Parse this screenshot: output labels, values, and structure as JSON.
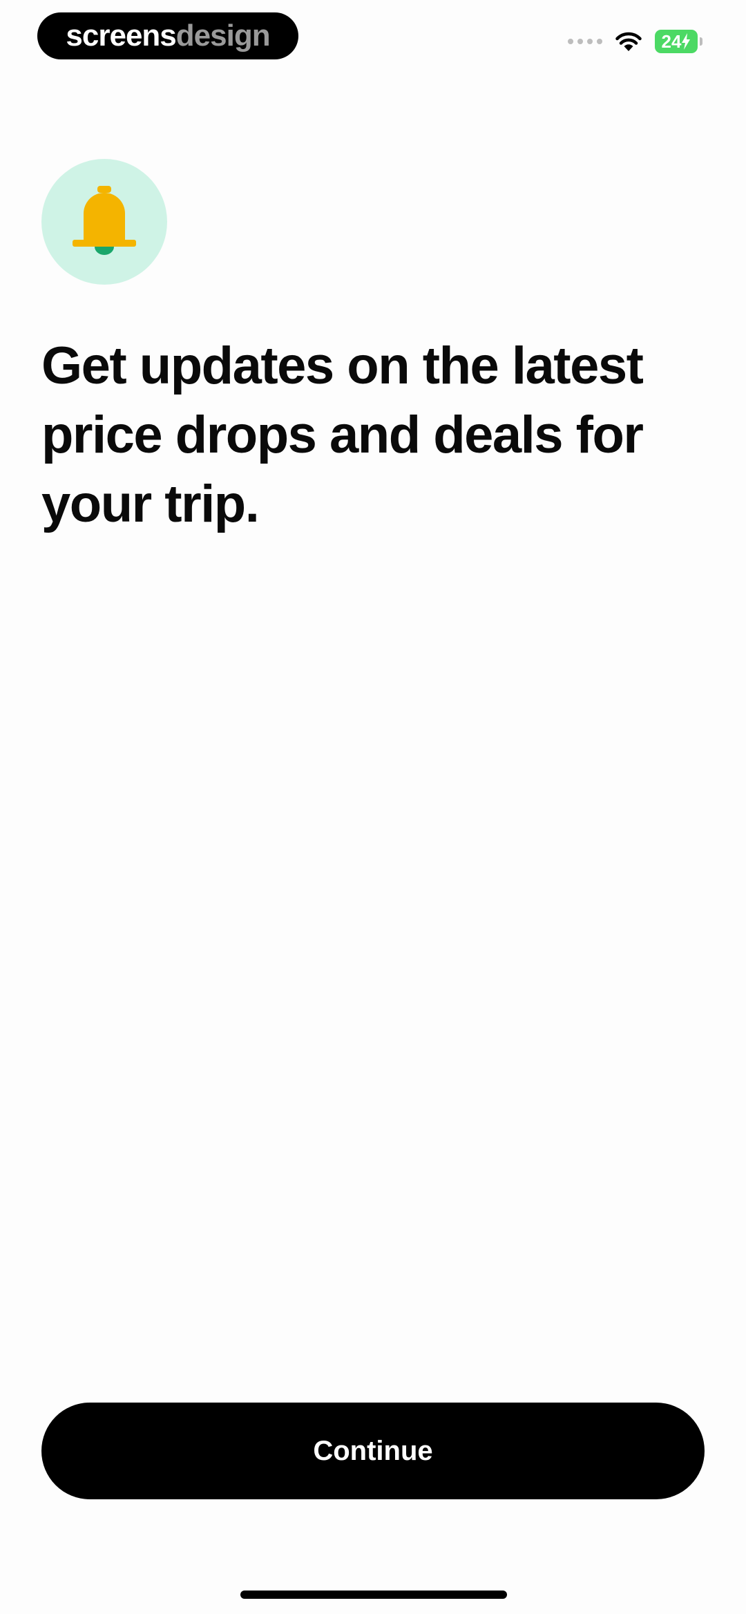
{
  "status_bar": {
    "brand_part1": "screens",
    "brand_part2": "design",
    "battery_level": "24",
    "battery_icon": "battery-charging-icon",
    "wifi_icon": "wifi-icon",
    "signal_icon": "signal-dots-icon"
  },
  "hero": {
    "icon": "bell-icon",
    "icon_colors": {
      "circle": "#cff3e6",
      "bell": "#f4b400",
      "clapper": "#1aa66b"
    },
    "headline": "Get updates on the latest price drops and deals for your trip."
  },
  "actions": {
    "continue_label": "Continue"
  },
  "colors": {
    "accent": "#000000",
    "background": "#fdfdfd",
    "battery": "#4cd964"
  }
}
